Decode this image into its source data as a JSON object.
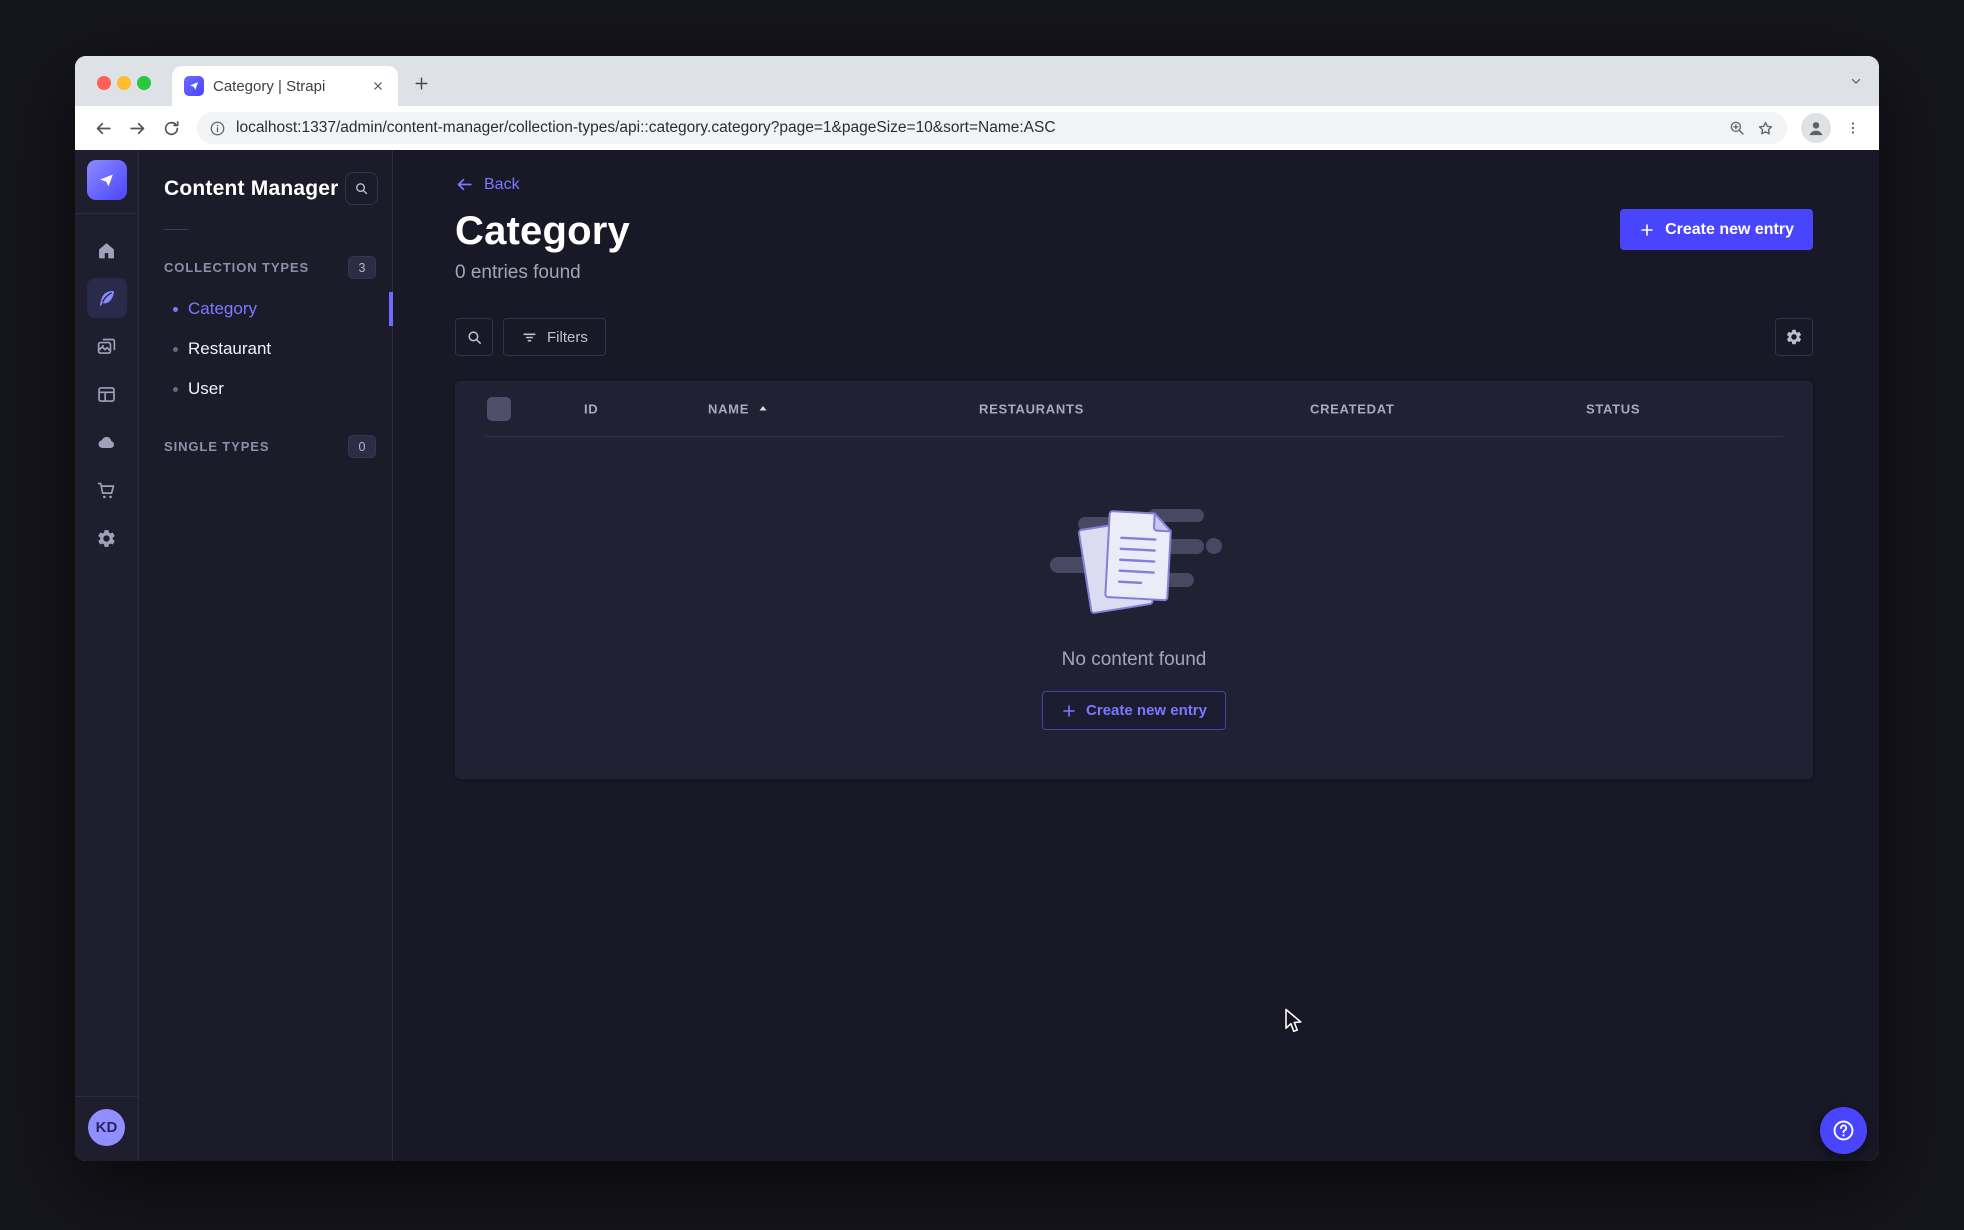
{
  "browser": {
    "tab_title": "Category | Strapi",
    "url": "localhost:1337/admin/content-manager/collection-types/api::category.category?page=1&pageSize=10&sort=Name:ASC"
  },
  "app": {
    "colors": {
      "primary": "#4945ff",
      "primary_light": "#7b79ff",
      "page_background": "#181826",
      "card_background": "#212134"
    },
    "icons": {
      "nav": [
        "strapi-logo",
        "home",
        "content-manager-feather",
        "media-library",
        "content-type-builder",
        "cloud",
        "marketplace-cart",
        "settings-gear"
      ],
      "misc": [
        "search",
        "filter",
        "plus",
        "back-arrow",
        "sort-ascending",
        "help-question",
        "gear"
      ]
    }
  },
  "subnav": {
    "title": "Content Manager",
    "sections": [
      {
        "label": "COLLECTION TYPES",
        "badge": "3",
        "items": [
          {
            "label": "Category",
            "active": true
          },
          {
            "label": "Restaurant",
            "active": false
          },
          {
            "label": "User",
            "active": false
          }
        ]
      },
      {
        "label": "SINGLE TYPES",
        "badge": "0",
        "items": []
      }
    ]
  },
  "main": {
    "back_label": "Back",
    "title": "Category",
    "entries_count": "0 entries found",
    "create_button_label": "Create new entry",
    "filters_label": "Filters",
    "table": {
      "columns": [
        "ID",
        "NAME",
        "RESTAURANTS",
        "CREATEDAT",
        "STATUS"
      ],
      "sorted_by": "NAME",
      "sort_direction": "ascending"
    },
    "empty_state": {
      "message": "No content found",
      "button_label": "Create new entry"
    }
  },
  "user": {
    "initials": "KD"
  }
}
